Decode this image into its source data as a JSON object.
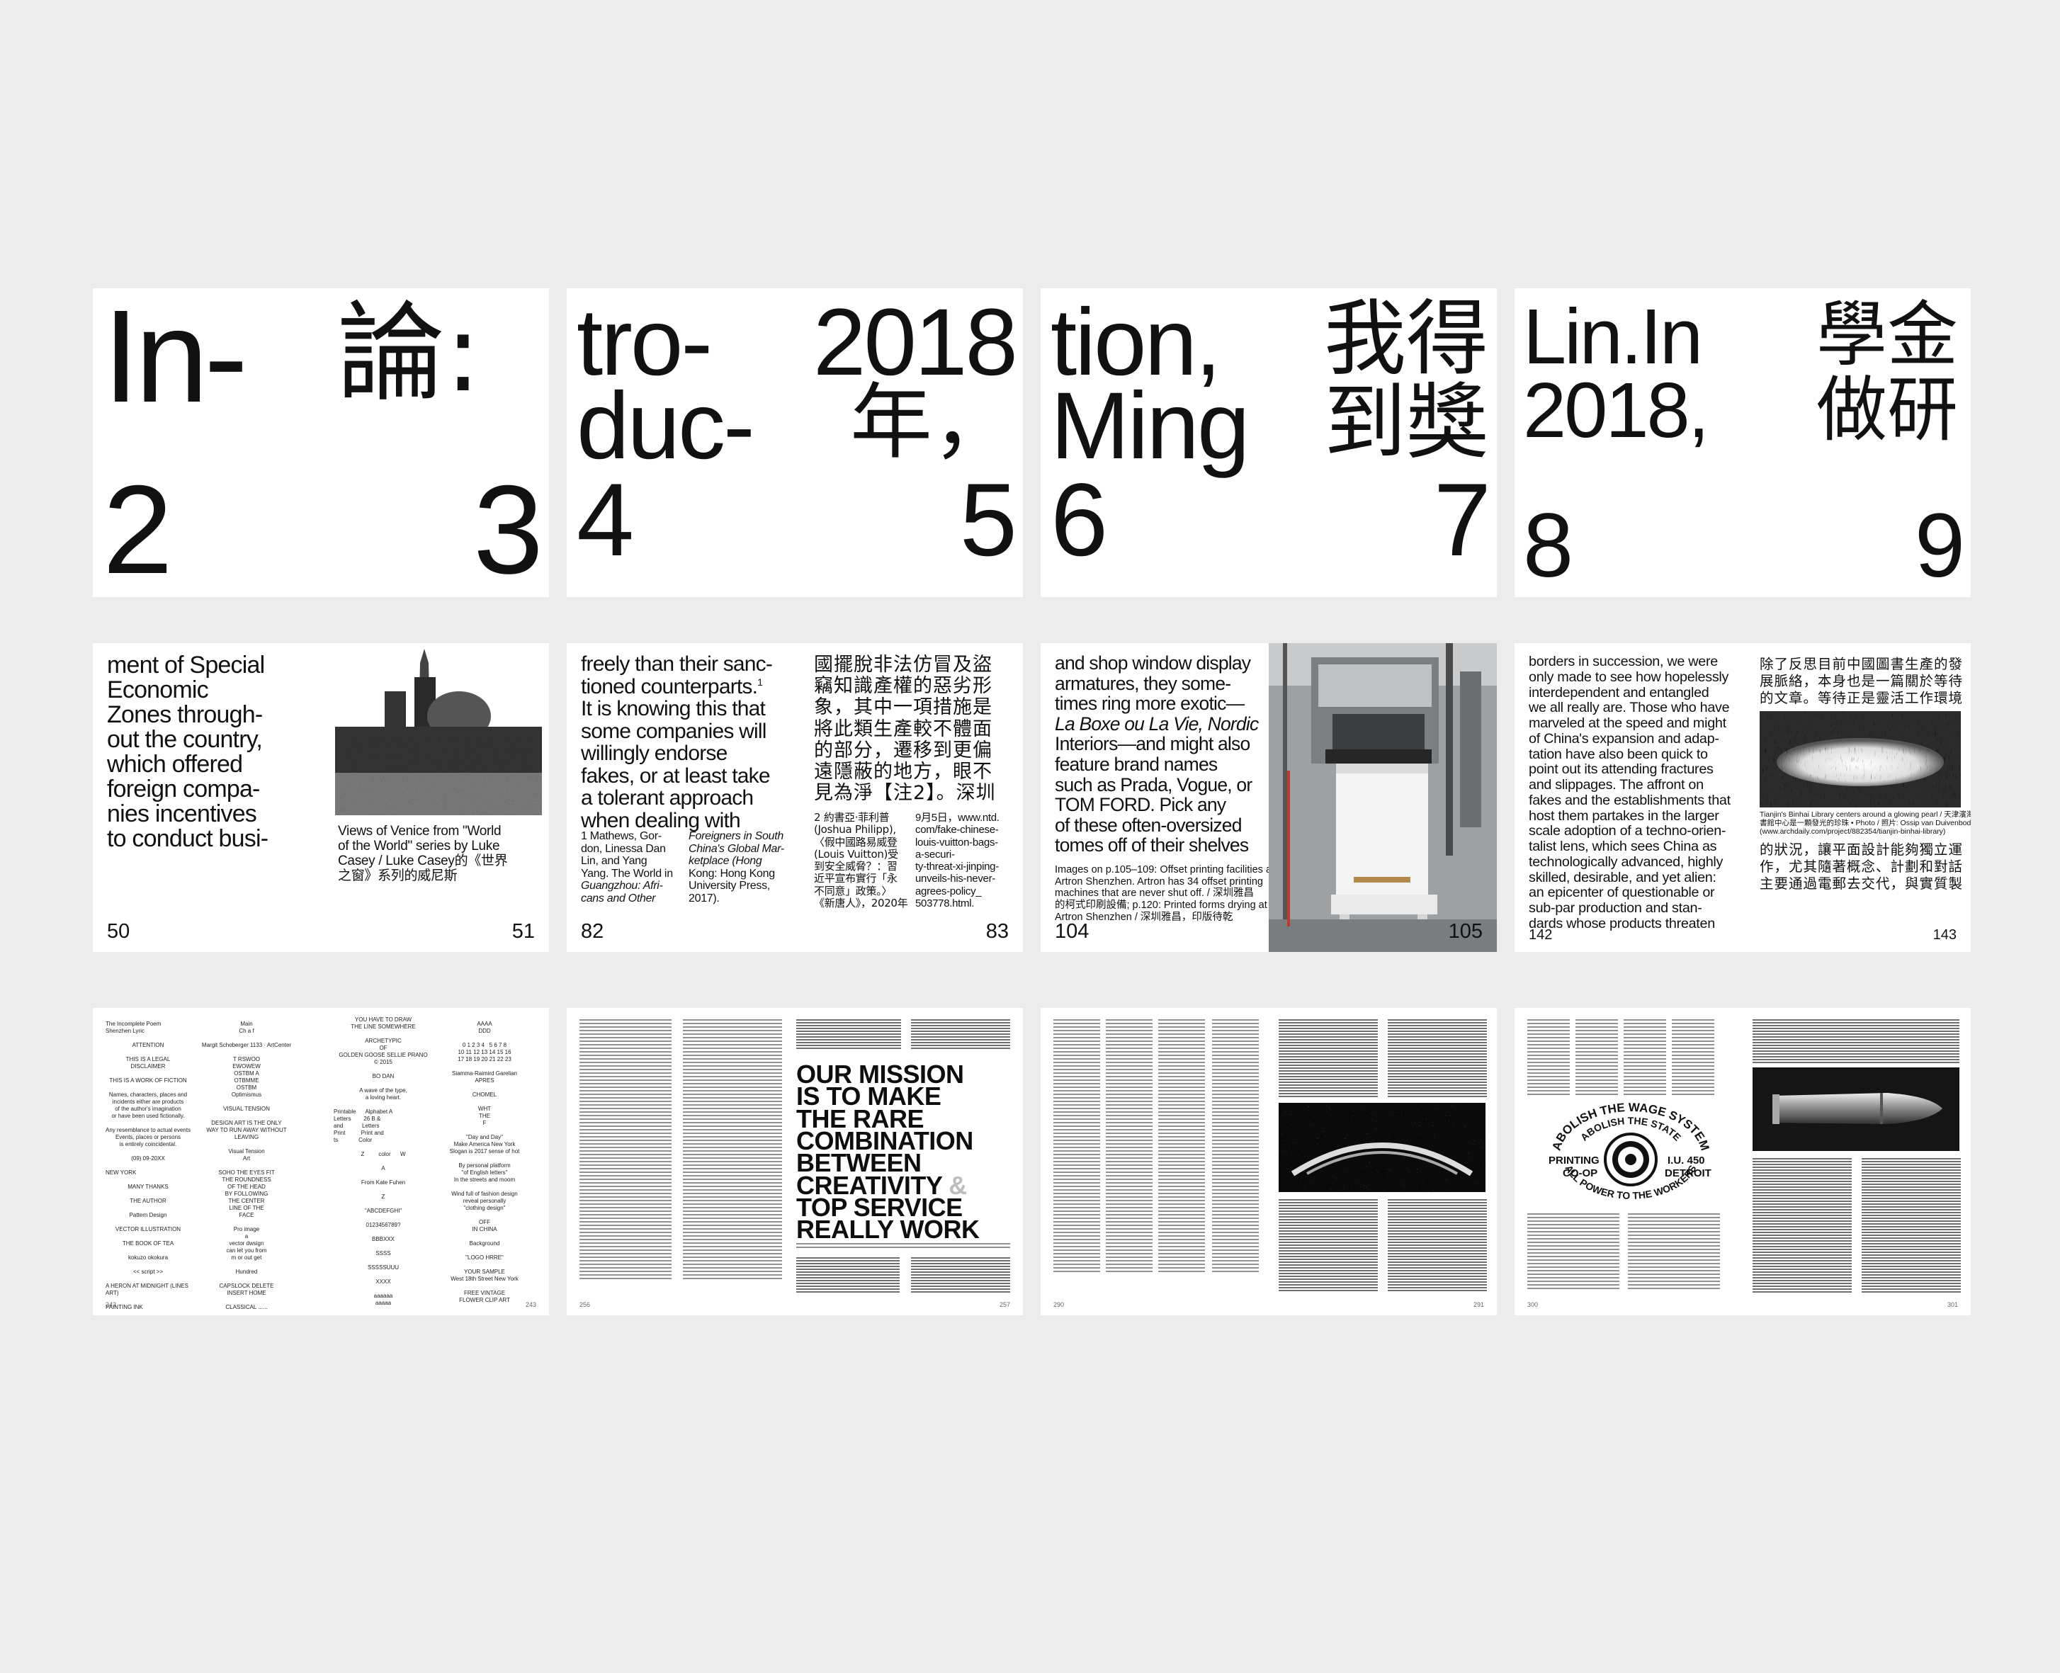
{
  "row1": [
    {
      "left_words": [
        "In-",
        "2"
      ],
      "right_words": [
        "論:",
        "3"
      ]
    },
    {
      "left_words": [
        "tro-",
        "duc-",
        "4"
      ],
      "right_words": [
        "2018",
        "年，",
        "5"
      ]
    },
    {
      "left_words": [
        "tion,",
        "Ming",
        "6"
      ],
      "right_words": [
        "我得",
        "到獎",
        "7"
      ]
    },
    {
      "left_words": [
        "Lin.In",
        "2018,",
        "8"
      ],
      "right_words": [
        "學金",
        "做研",
        "9"
      ]
    }
  ],
  "row2": {
    "s1": {
      "body": [
        "ment of Special",
        "Economic",
        "Zones through-",
        "out the country,",
        "which offered",
        "foreign compa-",
        "nies incentives",
        "to conduct busi-"
      ],
      "caption": [
        "Views of Venice from \"World",
        "of the World\" series by Luke",
        "Casey / Luke Casey的《世界",
        "之窗》系列的威尼斯"
      ],
      "pg_left": "50",
      "pg_right": "51"
    },
    "s2": {
      "body": [
        "freely than their sanc-",
        "tioned counterparts.",
        "It is knowing this that",
        "some companies will",
        "willingly endorse",
        "fakes, or at least take",
        "a tolerant approach",
        "when dealing with"
      ],
      "sup": "1",
      "fn_left": [
        "1   Mathews, Gor-",
        "don, Linessa Dan",
        "Lin, and Yang",
        "Yang. The World in",
        "Guangzhou: Afri-",
        "cans and Other"
      ],
      "fn_mid": [
        "Foreigners in South",
        "China's Global Mar-",
        "ketplace (Hong",
        "Kong: Hong Kong",
        "University Press,",
        "2017)."
      ],
      "cjk_body": [
        "國擺脫非法仿冒及盜",
        "竊知識產權的惡劣形",
        "象，其中一項措施是",
        "將此類生產較不體面",
        "的部分，遷移到更偏",
        "遠隱蔽的地方，眼不",
        "見為淨【注2】。深圳"
      ],
      "fn_cjk1": [
        "2  約書亞·菲利普",
        "(Joshua Philipp),",
        "〈假中國路易威登",
        "(Louis Vuitton)受",
        "到安全威脅？：習",
        "近平宣布實行「永",
        "不同意」政策。〉",
        "《新唐人》，2020年"
      ],
      "fn_cjk2": [
        "9月5日，www.ntd.",
        "com/fake-chinese-",
        "louis-vuitton-bags-",
        "a-securi-",
        "ty-threat-xi-jinping-",
        "unveils-his-never-",
        "agrees-policy_",
        "503778.html."
      ],
      "pg_left": "82",
      "pg_right": "83"
    },
    "s3": {
      "body": [
        "and shop window display",
        "armatures, they some-",
        "times ring more exotic—",
        "La Boxe ou La Vie, Nordic",
        "Interiors—and might also",
        "feature brand names",
        "such as Prada, Vogue, or",
        "TOM FORD. Pick any",
        "of these often-oversized",
        "tomes off of their shelves"
      ],
      "caption": [
        "Images on p.105–109: Offset printing facilities at",
        "Artron Shenzhen. Artron has 34 offset printing",
        "machines that are never shut off. / 深圳雅昌",
        "的柯式印刷設備; p.120: Printed forms drying at",
        "Artron Shenzhen / 深圳雅昌，印版待乾"
      ],
      "pg_left": "104",
      "pg_right": "105"
    },
    "s4": {
      "body": [
        "borders in succession, we were",
        "only made to see how hopelessly",
        "interdependent and entangled",
        "we all really are. Those who have",
        "marveled at the speed and might",
        "of China's expansion and adap-",
        "tation have also been quick to",
        "point out its attending fractures",
        "and slippages. The affront on",
        "fakes and the establishments that",
        "host them partakes in the larger",
        "scale adoption of a techno-orien-",
        "talist lens, which sees China as",
        "technologically advanced, highly",
        "skilled, desirable, and yet alien:",
        "an epicenter of questionable or",
        "sub-par production and stan-",
        "dards whose products threaten"
      ],
      "cjk_top": [
        "除了反思目前中國圖書生產的發",
        "展脈絡，本身也是一篇關於等待",
        "的文章。等待正是靈活工作環境"
      ],
      "caption": [
        "Tianjin's Binhai Library centers around a glowing pearl / 天津濱海圖",
        "書館中心是一顆發光的珍珠 • Photo / 照片: Ossip van Duivenbode",
        "(www.archdaily.com/project/882354/tianjin-binhai-library)"
      ],
      "cjk_bottom": [
        "的狀況，讓平面設計能夠獨立運",
        "作，尤其隨著概念、計劃和對話",
        "主要通過電郵去交代，與實質製"
      ],
      "pg_left": "142",
      "pg_right": "143"
    }
  },
  "row3": {
    "s1": {
      "col1": [
        "The Incomplete Poem",
        "Shenzhen Lyric",
        "",
        "ATTENTION",
        "",
        "THIS IS A LEGAL",
        "DISCLAIMER",
        "",
        "THIS IS A WORK OF FICTION",
        "",
        "Names, characters, places and",
        "incidents either are products",
        "of the author's imagination",
        "or have been used fictionally.",
        "",
        "Any resemblance to actual events",
        "Events, places or persons",
        "is entirely coincidental.",
        "",
        "(09) 09-20XX",
        "",
        "NEW YORK",
        "",
        "MANY THANKS",
        "",
        "THE AUTHOR",
        "",
        "Pattern Design",
        "",
        "VECTOR ILLUSTRATION",
        "",
        "THE BOOK OF TEA",
        "",
        "kokuzo okokura",
        "",
        "<< script >>",
        "",
        "A HERON AT MIDNIGHT (LINES",
        "ART)",
        "",
        "PAINTING INK"
      ],
      "col2": [
        "Main",
        "Ch a f",
        "",
        "Margit Schoberger 1133 · ArtCenter",
        "",
        "T RSWOO",
        "EWOWEW",
        "OSTBM A",
        "OTBMME",
        "OSTBM",
        "Optimismus",
        "",
        "VISUAL TENSION",
        "",
        "DESIGN      ART IS THE ONLY",
        "WAY TO RUN AWAY WITHOUT",
        "LEAVING",
        "",
        "Visual Tension",
        "Art",
        "",
        "SOHO   THE EYES FIT",
        "THE ROUNDNESS",
        "OF THE HEAD",
        "BY FOLLOWING",
        "THE CENTER",
        "LINE OF THE",
        "FACE",
        "",
        "Pro image",
        "a",
        "vector dwsign",
        "can let you from",
        "m or out get",
        "",
        "Hundred",
        "",
        "CAPSLOCK DELETE",
        "INSERT HOME",
        "",
        "CLASSICAL ......"
      ],
      "col3": [
        "YOU HAVE TO DRAW",
        "THE LINE SOMEWHERE",
        "",
        "ARCHETYPIC",
        "OF",
        "GOLDEN GOOSE SELLIE PRANO",
        "© 2015",
        "",
        "BO DAN",
        "",
        "A wave of the type,",
        "a loving heart.",
        "",
        "Printable      Alphabet A",
        "Letters        26 B &",
        "and            Letters",
        "Print          Print and",
        "ts             Color",
        "",
        "Z         color      W",
        "",
        "A",
        "",
        "From Kate Fuhen",
        "",
        "Z",
        "",
        "\"ABCDEFGHI\"",
        "",
        "0123456789?",
        "",
        "BBBXXX",
        "",
        "SSSS",
        "",
        "SSSSSUUU",
        "",
        "XXXX",
        "",
        "aaaaaa",
        "aaaaa"
      ],
      "col4": [
        "AAAA",
        "DDD",
        "",
        "0 1 2 3 4   5 6 7 8",
        "10 11 12 13 14 15 16",
        "17 18 19 20 21 22 23",
        "",
        "Siamma-Raimird Garelian",
        "APRES",
        "",
        "CHOMEL",
        "",
        "WHT",
        "THE",
        "F",
        "",
        "\"Day and Day\"",
        "Make America New York",
        "Slogan is 2017 sense of hot",
        "",
        "By personal platform",
        "\"of English letters\"",
        "In the streets and moom",
        "",
        "Wind full of fashion design",
        "reveal personally",
        "\"clothing design\"",
        "",
        "OFF",
        "IN CHINA",
        "",
        "Background",
        "",
        "\"LOGO HRRE\"",
        "",
        "YOUR SAMPLE",
        "West 18th Street New York",
        "",
        "FREE VINTAGE",
        "FLOWER CLIP ART"
      ],
      "pg_left": "242",
      "pg_right": "243"
    },
    "s2": {
      "mission": [
        "OUR MISSION",
        "IS TO MAKE",
        "THE RARE",
        "COMBINATION",
        "BETWEEN",
        "CREATIVITY",
        "TOP SERVICE",
        "REALLY WORK"
      ],
      "ampersand": "&",
      "pg_left": "256",
      "pg_right": "257"
    },
    "s3": {
      "pg_left": "290",
      "pg_right": "291"
    },
    "s4": {
      "seal_top": "ABOLISH THE WAGE SYSTEM",
      "seal_second": "ABOLISH THE STATE",
      "seal_left1": "PRINTING",
      "seal_left2": "CO-OP",
      "seal_right1": "I.U. 450",
      "seal_right2": "DETROIT",
      "seal_bottom": "ALL POWER TO THE WORKERS",
      "pg_left": "300",
      "pg_right": "301"
    }
  }
}
